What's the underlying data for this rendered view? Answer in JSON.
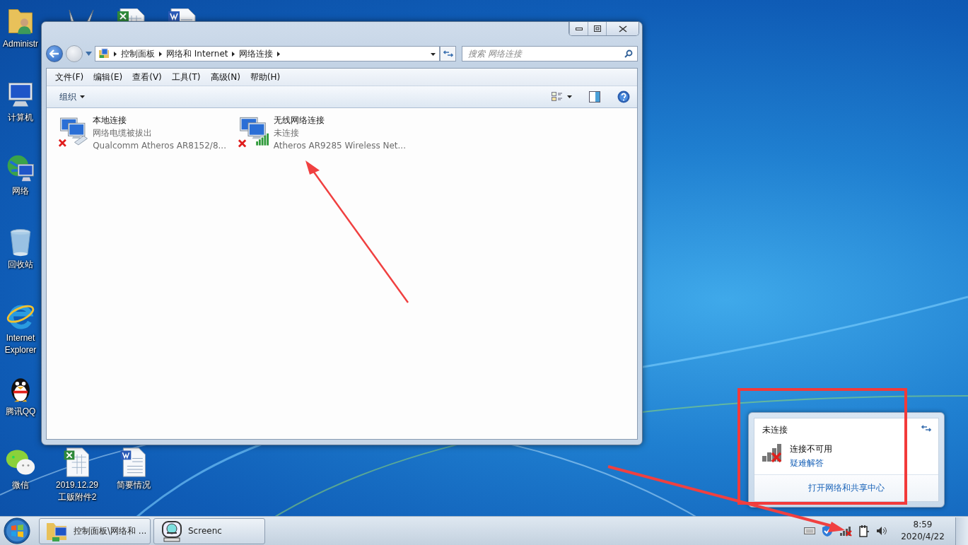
{
  "desktop_icons_top": [
    {
      "kind": "rabbit"
    },
    {
      "kind": "excel"
    },
    {
      "kind": "word"
    }
  ],
  "desktop_icons": [
    {
      "kind": "user-folder",
      "label": "Administr"
    },
    {
      "kind": "computer",
      "label": "计算机"
    },
    {
      "kind": "network",
      "label": "网络"
    },
    {
      "kind": "recycle",
      "label": "回收站"
    },
    {
      "kind": "browser",
      "label": "Internet Explorer"
    },
    {
      "kind": "penguin",
      "label": "腾讯QQ"
    },
    {
      "kind": "chat",
      "label": "微信"
    }
  ],
  "desktop_icons_bottom": [
    {
      "kind": "excel",
      "label": "2019.12.29 工贩附件2"
    },
    {
      "kind": "word",
      "label": "简要情况"
    }
  ],
  "window": {
    "breadcrumbs": [
      "控制面板",
      "网络和 Internet",
      "网络连接"
    ],
    "search": {
      "placeholder": "搜索 网络连接"
    },
    "menu": [
      "文件(F)",
      "编辑(E)",
      "查看(V)",
      "工具(T)",
      "高级(N)",
      "帮助(H)"
    ],
    "toolbar": {
      "organize": "组织"
    },
    "connections": [
      {
        "kind": "wired",
        "name": "本地连接",
        "status": "网络电缆被拔出",
        "adapter": "Qualcomm Atheros AR8152/8...",
        "connected": false
      },
      {
        "kind": "wireless",
        "name": "无线网络连接",
        "status": "未连接",
        "adapter": "Atheros AR9285 Wireless Net...",
        "connected": false
      }
    ]
  },
  "network_popup": {
    "title": "未连接",
    "message": "连接不可用",
    "troubleshoot_link": "疑难解答",
    "footer_link": "打开网络和共享中心"
  },
  "taskbar": {
    "tasks": [
      {
        "kind": "explorer",
        "label": "控制面板\\网络和 ..."
      },
      {
        "kind": "recorder",
        "label": "Screenc"
      }
    ],
    "time": "8:59",
    "date": "2020/4/22"
  }
}
